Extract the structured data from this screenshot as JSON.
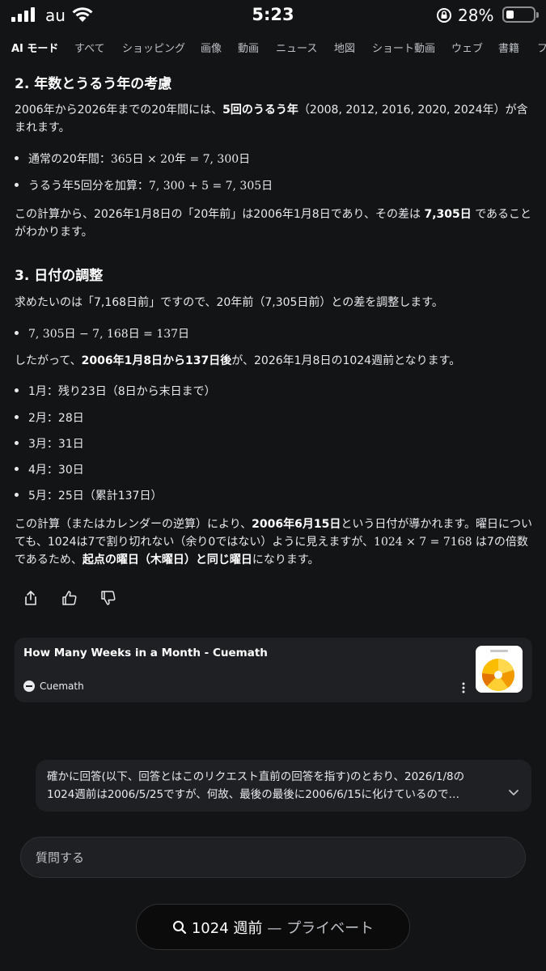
{
  "status": {
    "carrier": "au",
    "time": "5:23",
    "battery": "28%",
    "battery_level": 0.28
  },
  "tabs": [
    {
      "label": "AI モード",
      "active": true
    },
    {
      "label": "すべて"
    },
    {
      "label": "ショッピング"
    },
    {
      "label": "画像"
    },
    {
      "label": "動画"
    },
    {
      "label": "ニュース"
    },
    {
      "label": "地図"
    },
    {
      "label": "ショート動画"
    },
    {
      "label": "ウェブ"
    },
    {
      "label": "書籍"
    },
    {
      "label": "フ"
    }
  ],
  "section2": {
    "heading": "2. 年数とうるう年の考慮",
    "p1_a": "2006年から2026年までの20年間には、",
    "p1_b": "5回のうるう年",
    "p1_c": "（2008, 2012, 2016, 2020, 2024年）が含まれます。",
    "bullets": [
      {
        "label": "通常の20年間：",
        "math": "365日 × 20年 = 7, 300日"
      },
      {
        "label": "うるう年5回分を加算：",
        "math": "7, 300 + 5 = 7, 305日"
      }
    ],
    "p2_a": "この計算から、2026年1月8日の「20年前」は2006年1月8日であり、その差は ",
    "p2_b": "7,305日",
    "p2_c": " であることがわかります。"
  },
  "section3": {
    "heading": "3. 日付の調整",
    "p1": "求めたいのは「7,168日前」ですので、20年前（7,305日前）との差を調整します。",
    "bullet_math": "7, 305日 − 7, 168日 = 137日",
    "p2_a": "したがって、",
    "p2_b": "2006年1月8日から137日後",
    "p2_c": "が、2026年1月8日の1024週前となります。",
    "months": [
      "1月：残り23日（8日から末日まで）",
      "2月：28日",
      "3月：31日",
      "4月：30日",
      "5月：25日（累計137日）"
    ],
    "p3_a": "この計算（またはカレンダーの逆算）により、",
    "p3_b": "2006年6月15日",
    "p3_c": "という日付が導かれます。曜日についても、1024は7で割り切れない（余り0ではない）ように見えますが、",
    "p3_math": "1024 × 7 = 7168",
    "p3_d": " は7の倍数であるため、",
    "p3_e": "起点の曜日（木曜日）と同じ曜日",
    "p3_f": "になります。"
  },
  "source_card": {
    "title": "How Many Weeks in a Month - Cuemath",
    "source": "Cuemath"
  },
  "user_message": {
    "line1": "確かに回答(以下、回答とはこのリクエスト直前の回答を指す)のとおり、2026/1/8の",
    "line2": "1024週前は2006/5/25ですが、何故、最後の最後に2006/6/15に化けているので…"
  },
  "ask": {
    "placeholder": "質問する"
  },
  "privacy_pill": {
    "query": "1024 週前",
    "mode": "— プライベート"
  },
  "icons": [
    "signal-icon",
    "wifi-icon",
    "rotation-lock-icon",
    "battery-icon",
    "share-icon",
    "thumbs-up-icon",
    "thumbs-down-icon",
    "kebab-menu-icon",
    "chevron-down-icon",
    "search-icon"
  ]
}
